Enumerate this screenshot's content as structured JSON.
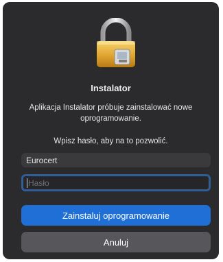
{
  "dialog": {
    "title": "Instalator",
    "message": "Aplikacja Instalator próbuje zainstalować nowe oprogramowanie.",
    "prompt": "Wpisz hasło, aby na to pozwolić.",
    "username_value": "Eurocert",
    "password_placeholder": "Hasło",
    "install_label": "Zainstaluj oprogramowanie",
    "cancel_label": "Anuluj",
    "icon": "lock-icon"
  },
  "colors": {
    "dialog_bg": "#2b2a2d",
    "accent": "#1f6fd6",
    "focus_ring": "#2f5f96",
    "secondary_button": "#57565a"
  }
}
